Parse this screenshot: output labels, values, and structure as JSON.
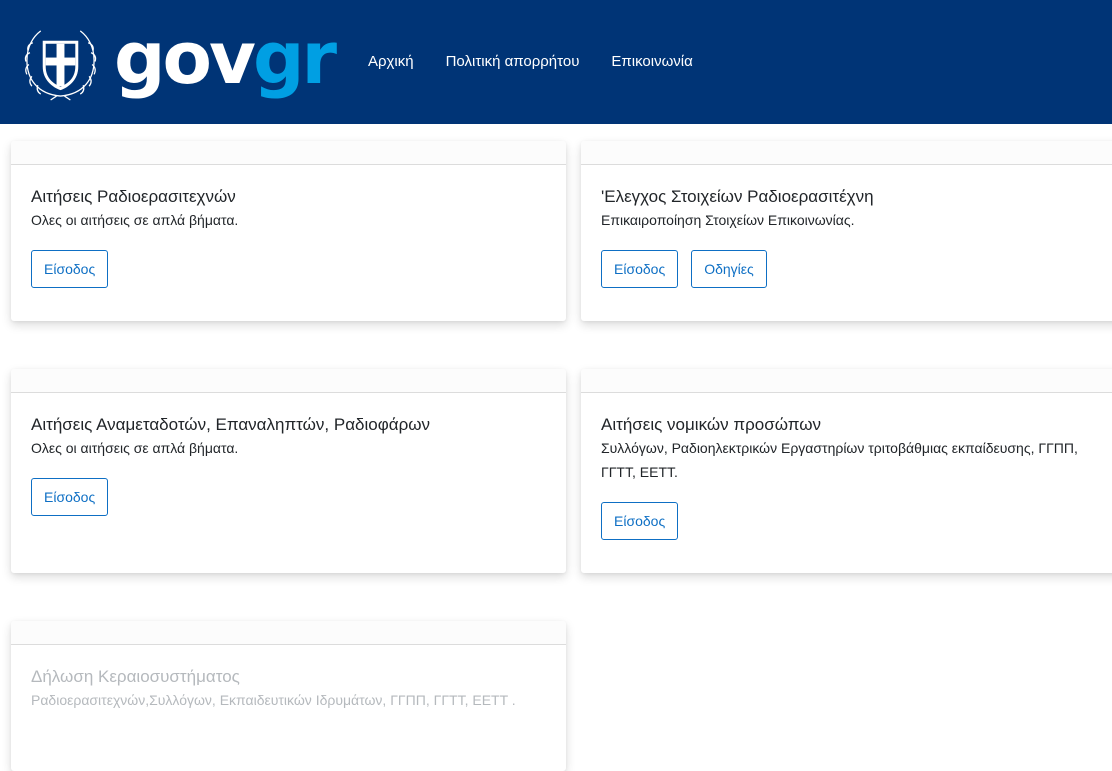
{
  "header": {
    "logo_gov": "gov",
    "logo_gr": "gr",
    "nav": [
      {
        "label": "Αρχική"
      },
      {
        "label": "Πολιτική απορρήτου"
      },
      {
        "label": "Επικοινωνία"
      }
    ]
  },
  "cards": [
    {
      "title": "Αιτήσεις Ραδιοερασιτεχνών",
      "text": "Ολες οι αιτήσεις σε απλά βήματα.",
      "buttons": [
        {
          "label": "Είσοδος"
        }
      ]
    },
    {
      "title": "'Ελεγχος Στοιχείων Ραδιοερασιτέχνη",
      "text": "Επικαιροποίηση Στοιχείων Επικοινωνίας.",
      "buttons": [
        {
          "label": "Είσοδος"
        },
        {
          "label": "Οδηγίες"
        }
      ]
    },
    {
      "title": "Αιτήσεις Αναμεταδοτών, Επαναληπτών, Ραδιοφάρων",
      "text": "Ολες οι αιτήσεις σε απλά βήματα.",
      "buttons": [
        {
          "label": "Είσοδος"
        }
      ]
    },
    {
      "title": "Αιτήσεις νομικών προσώπων",
      "text": "Συλλόγων, Ραδιοηλεκτρικών Εργαστηρίων τριτοβάθμιας εκπαίδευσης, ΓΓΠΠ, ΓΓΤΤ, ΕΕΤΤ.",
      "buttons": [
        {
          "label": "Είσοδος"
        }
      ]
    },
    {
      "title": "Δήλωση Κεραιοσυστήματος",
      "text": "Ραδιοερασιτεχνών,Συλλόγων, Εκπαιδευτικών Ιδρυμάτων, ΓΓΠΠ, ΓΓΤΤ, ΕΕΤΤ ."
    }
  ],
  "colors": {
    "header_bg": "#003476",
    "accent": "#009fe3",
    "button": "#0e6fc4"
  },
  "icons": [
    "greek-coat-of-arms-icon"
  ]
}
